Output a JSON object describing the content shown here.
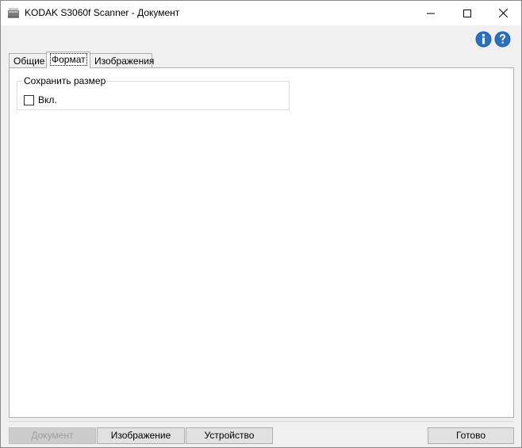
{
  "window": {
    "title": "KODAK S3060f Scanner - Документ"
  },
  "icons": {
    "app": "scanner-icon",
    "minimize": "minimize-icon",
    "maximize": "maximize-icon",
    "close": "close-icon",
    "info": "info-icon",
    "help": "help-icon"
  },
  "tabs": [
    {
      "label": "Общие",
      "selected": false
    },
    {
      "label": "Формат",
      "selected": true
    },
    {
      "label": "Изображения",
      "selected": false
    }
  ],
  "panel": {
    "group_title": "Сохранить размер",
    "checkbox_label": "Вкл.",
    "checkbox_checked": false
  },
  "footer": {
    "document_label": "Документ",
    "image_label": "Изображение",
    "device_label": "Устройство",
    "done_label": "Готово"
  },
  "colors": {
    "info_blue": "#1f5fa8",
    "background": "#f0f0f0",
    "panel": "#ffffff"
  }
}
